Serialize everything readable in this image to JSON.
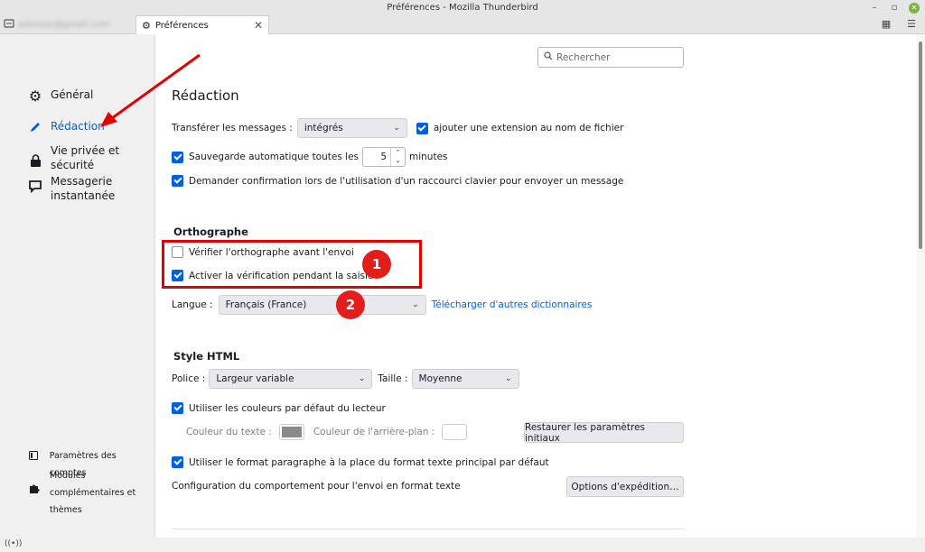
{
  "window": {
    "title": "Préférences - Mozilla Thunderbird"
  },
  "tabs": {
    "mail_tab_label": "adresse@gmail.com",
    "prefs_tab_label": "Préférences"
  },
  "search": {
    "placeholder": "Rechercher"
  },
  "sidebar": {
    "items": [
      {
        "label": "Général",
        "icon": "gear-icon"
      },
      {
        "label": "Rédaction",
        "icon": "pencil-icon",
        "active": true
      },
      {
        "label1": "Vie privée et",
        "label2": "sécurité",
        "icon": "lock-icon"
      },
      {
        "label1": "Messagerie",
        "label2": "instantanée",
        "icon": "chat-icon"
      }
    ],
    "bottom": [
      {
        "label": "Paramètres des comptes",
        "icon": "account-icon"
      },
      {
        "label1": "Modules",
        "label2": "complémentaires et",
        "label3": "thèmes",
        "icon": "puzzle-icon"
      }
    ]
  },
  "main": {
    "title": "Rédaction",
    "forward_label": "Transférer les messages :",
    "forward_value": "intégrés",
    "add_extension_label": "ajouter une extension au nom de fichier",
    "autosave_label": "Sauvegarde automatique toutes les",
    "autosave_value": "5",
    "autosave_unit": "minutes",
    "confirm_label": "Demander confirmation lors de l'utilisation d'un raccourci clavier pour envoyer un message",
    "spelling_heading": "Orthographe",
    "check_before_send_label": "Vérifier l'orthographe avant l'envoi",
    "check_while_typing_label": "Activer la vérification pendant la saisie",
    "language_label": "Langue :",
    "language_value": "Français (France)",
    "download_dicts_link": "Télécharger d'autres dictionnaires",
    "html_heading": "Style HTML",
    "font_label": "Police :",
    "font_value": "Largeur variable",
    "size_label": "Taille :",
    "size_value": "Moyenne",
    "reader_colors_label": "Utiliser les couleurs par défaut du lecteur",
    "text_color_label": "Couleur du texte :",
    "bg_color_label": "Couleur de l'arrière-plan :",
    "restore_button": "Restaurer les paramètres initiaux",
    "paragraph_format_label": "Utiliser le format paragraphe à la place du format texte principal par défaut",
    "send_config_label": "Configuration du comportement pour l'envoi en format texte",
    "send_options_button": "Options d'expédition…"
  },
  "annotations": {
    "badge1": "1",
    "badge2": "2"
  },
  "colors": {
    "accent": "#0061e0",
    "annotation_red": "#e31c1c",
    "text_color_swatch": "#8a8a8a",
    "bg_color_swatch": "#ffffff"
  }
}
